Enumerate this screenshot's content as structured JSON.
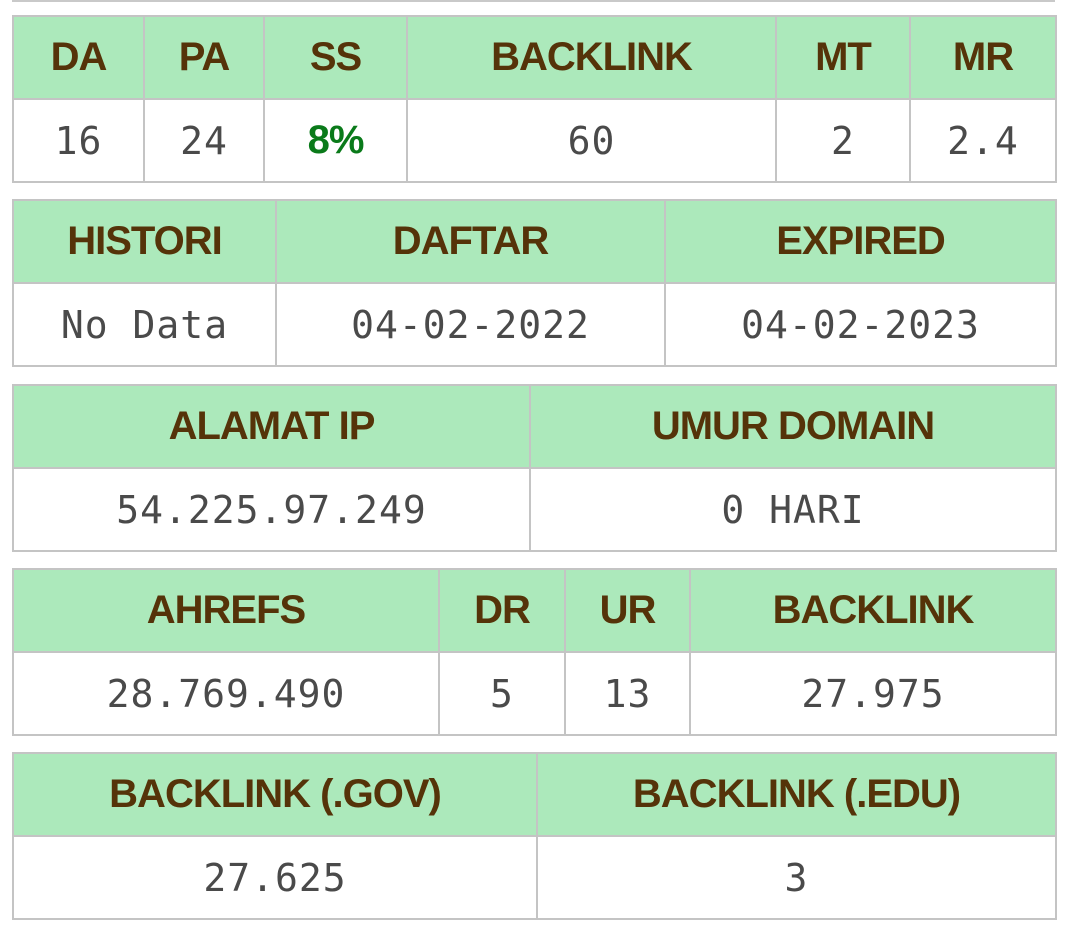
{
  "metrics": {
    "headers": [
      "DA",
      "PA",
      "SS",
      "BACKLINK",
      "MT",
      "MR"
    ],
    "values": [
      "16",
      "24",
      "8%",
      "60",
      "2",
      "2.4"
    ]
  },
  "history": {
    "headers": [
      "HISTORI",
      "DAFTAR",
      "EXPIRED"
    ],
    "values": [
      "No Data",
      "04-02-2022",
      "04-02-2023"
    ]
  },
  "server": {
    "headers": [
      "ALAMAT IP",
      "UMUR DOMAIN"
    ],
    "values": [
      "54.225.97.249",
      "0 HARI"
    ]
  },
  "ahrefs": {
    "headers": [
      "AHREFS",
      "DR",
      "UR",
      "BACKLINK"
    ],
    "values": [
      "28.769.490",
      "5",
      "13",
      "27.975"
    ]
  },
  "special_backlinks": {
    "headers": [
      "BACKLINK (.GOV)",
      "BACKLINK (.EDU)"
    ],
    "values": [
      "27.625",
      "3"
    ]
  },
  "colors": {
    "header_bg": "#ace9bb",
    "header_text": "#553309",
    "value_text": "#4a4a4a",
    "highlight_text": "#0a7a1a",
    "border": "#c4c4c4"
  }
}
